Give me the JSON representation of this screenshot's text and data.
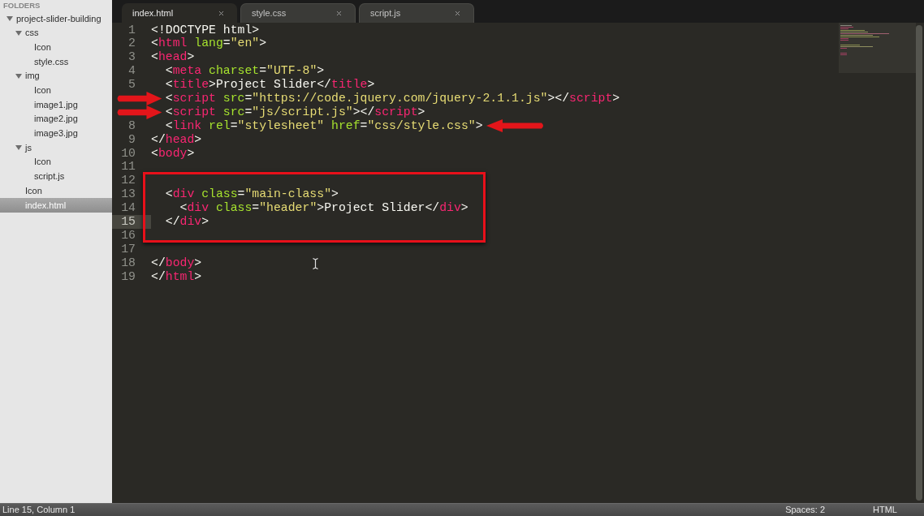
{
  "sidebar": {
    "header": "FOLDERS",
    "tree": [
      {
        "name": "project-slider-building",
        "kind": "folder",
        "expanded": true,
        "selected": false,
        "children": [
          {
            "name": "css",
            "kind": "folder",
            "expanded": true,
            "selected": false,
            "children": [
              {
                "name": "Icon",
                "kind": "file",
                "selected": false
              },
              {
                "name": "style.css",
                "kind": "file",
                "selected": false
              }
            ]
          },
          {
            "name": "img",
            "kind": "folder",
            "expanded": true,
            "selected": false,
            "children": [
              {
                "name": "Icon",
                "kind": "file",
                "selected": false
              },
              {
                "name": "image1.jpg",
                "kind": "file",
                "selected": false
              },
              {
                "name": "image2.jpg",
                "kind": "file",
                "selected": false
              },
              {
                "name": "image3.jpg",
                "kind": "file",
                "selected": false
              }
            ]
          },
          {
            "name": "js",
            "kind": "folder",
            "expanded": true,
            "selected": false,
            "children": [
              {
                "name": "Icon",
                "kind": "file",
                "selected": false
              },
              {
                "name": "script.js",
                "kind": "file",
                "selected": false
              }
            ]
          },
          {
            "name": "Icon",
            "kind": "file",
            "selected": false
          },
          {
            "name": "index.html",
            "kind": "file",
            "selected": true
          }
        ]
      }
    ]
  },
  "tabs": [
    {
      "label": "index.html",
      "selected": true
    },
    {
      "label": "style.css",
      "selected": false
    },
    {
      "label": "script.js",
      "selected": false
    }
  ],
  "editor": {
    "lines": [
      {
        "number": "1",
        "current": false,
        "boxed": false,
        "tokens": [
          {
            "kind": "plain",
            "text": "<!DOCTYPE html>"
          }
        ]
      },
      {
        "number": "2",
        "current": false,
        "boxed": false,
        "tokens": [
          {
            "kind": "plain",
            "text": "<"
          },
          {
            "kind": "tag",
            "text": "html"
          },
          {
            "kind": "attr",
            "text": " lang"
          },
          {
            "kind": "plain",
            "text": "="
          },
          {
            "kind": "string",
            "text": "\"en\""
          },
          {
            "kind": "plain",
            "text": ">"
          }
        ]
      },
      {
        "number": "3",
        "current": false,
        "boxed": false,
        "tokens": [
          {
            "kind": "plain",
            "text": "<"
          },
          {
            "kind": "tag",
            "text": "head"
          },
          {
            "kind": "plain",
            "text": ">"
          }
        ]
      },
      {
        "number": "4",
        "current": false,
        "boxed": false,
        "tokens": [
          {
            "kind": "plain",
            "text": "  <"
          },
          {
            "kind": "tag",
            "text": "meta"
          },
          {
            "kind": "attr",
            "text": " charset"
          },
          {
            "kind": "plain",
            "text": "="
          },
          {
            "kind": "string",
            "text": "\"UTF-8\""
          },
          {
            "kind": "plain",
            "text": ">"
          }
        ]
      },
      {
        "number": "5",
        "current": false,
        "boxed": false,
        "tokens": [
          {
            "kind": "plain",
            "text": "  <"
          },
          {
            "kind": "tag",
            "text": "title"
          },
          {
            "kind": "plain",
            "text": ">Project Slider</"
          },
          {
            "kind": "tag",
            "text": "title"
          },
          {
            "kind": "plain",
            "text": ">"
          }
        ]
      },
      {
        "current": false,
        "boxed": false,
        "annotation": {
          "kind": "arrow-right"
        },
        "tokens": [
          {
            "kind": "plain",
            "text": "  <"
          },
          {
            "kind": "tag",
            "text": "script"
          },
          {
            "kind": "attr",
            "text": " src"
          },
          {
            "kind": "plain",
            "text": "="
          },
          {
            "kind": "string",
            "text": "\"https://code.jquery.com/jquery-2.1.1.js\""
          },
          {
            "kind": "plain",
            "text": "></"
          },
          {
            "kind": "tag",
            "text": "script"
          },
          {
            "kind": "plain",
            "text": ">"
          }
        ]
      },
      {
        "current": false,
        "boxed": false,
        "annotation": {
          "kind": "arrow-right"
        },
        "tokens": [
          {
            "kind": "plain",
            "text": "  <"
          },
          {
            "kind": "tag",
            "text": "script"
          },
          {
            "kind": "attr",
            "text": " src"
          },
          {
            "kind": "plain",
            "text": "="
          },
          {
            "kind": "string",
            "text": "\"js/script.js\""
          },
          {
            "kind": "plain",
            "text": "></"
          },
          {
            "kind": "tag",
            "text": "script"
          },
          {
            "kind": "plain",
            "text": ">"
          }
        ]
      },
      {
        "number": "8",
        "current": false,
        "boxed": false,
        "annotation": {
          "kind": "arrow-left"
        },
        "tokens": [
          {
            "kind": "plain",
            "text": "  <"
          },
          {
            "kind": "tag",
            "text": "link"
          },
          {
            "kind": "attr",
            "text": " rel"
          },
          {
            "kind": "plain",
            "text": "="
          },
          {
            "kind": "string",
            "text": "\"stylesheet\""
          },
          {
            "kind": "attr",
            "text": " href"
          },
          {
            "kind": "plain",
            "text": "="
          },
          {
            "kind": "string",
            "text": "\"css/style.css\""
          },
          {
            "kind": "plain",
            "text": ">"
          }
        ]
      },
      {
        "number": "9",
        "current": false,
        "boxed": false,
        "tokens": [
          {
            "kind": "plain",
            "text": "</"
          },
          {
            "kind": "tag",
            "text": "head"
          },
          {
            "kind": "plain",
            "text": ">"
          }
        ]
      },
      {
        "number": "10",
        "current": false,
        "boxed": false,
        "tokens": [
          {
            "kind": "plain",
            "text": "<"
          },
          {
            "kind": "tag",
            "text": "body"
          },
          {
            "kind": "plain",
            "text": ">"
          }
        ]
      },
      {
        "number": "11",
        "current": false,
        "boxed": false
      },
      {
        "number": "12",
        "current": false,
        "boxed": true
      },
      {
        "number": "13",
        "current": false,
        "boxed": true,
        "tokens": [
          {
            "kind": "plain",
            "text": "  <"
          },
          {
            "kind": "tag",
            "text": "div"
          },
          {
            "kind": "attr",
            "text": " class"
          },
          {
            "kind": "plain",
            "text": "="
          },
          {
            "kind": "string",
            "text": "\"main-class\""
          },
          {
            "kind": "plain",
            "text": ">"
          }
        ]
      },
      {
        "number": "14",
        "current": false,
        "boxed": true,
        "tokens": [
          {
            "kind": "plain",
            "text": "    <"
          },
          {
            "kind": "tag",
            "text": "div"
          },
          {
            "kind": "attr",
            "text": " class"
          },
          {
            "kind": "plain",
            "text": "="
          },
          {
            "kind": "string",
            "text": "\"header\""
          },
          {
            "kind": "plain",
            "text": ">Project Slider</"
          },
          {
            "kind": "tag",
            "text": "div"
          },
          {
            "kind": "plain",
            "text": ">"
          }
        ]
      },
      {
        "number": "15",
        "current": true,
        "boxed": true,
        "tokens": [
          {
            "kind": "plain",
            "text": "  </"
          },
          {
            "kind": "tag",
            "text": "div"
          },
          {
            "kind": "plain",
            "text": ">"
          }
        ]
      },
      {
        "number": "16",
        "current": false,
        "boxed": true
      },
      {
        "number": "17",
        "current": false,
        "boxed": false
      },
      {
        "number": "18",
        "current": false,
        "boxed": false,
        "tokens": [
          {
            "kind": "plain",
            "text": "</"
          },
          {
            "kind": "tag",
            "text": "body"
          },
          {
            "kind": "plain",
            "text": ">"
          }
        ]
      },
      {
        "number": "19",
        "current": false,
        "boxed": false,
        "tokens": [
          {
            "kind": "plain",
            "text": "</"
          },
          {
            "kind": "tag",
            "text": "html"
          },
          {
            "kind": "plain",
            "text": ">"
          }
        ]
      }
    ]
  },
  "status_bar": {
    "position": "Line 15, Column 1",
    "indentation": "Spaces: 2",
    "syntax": "HTML"
  }
}
